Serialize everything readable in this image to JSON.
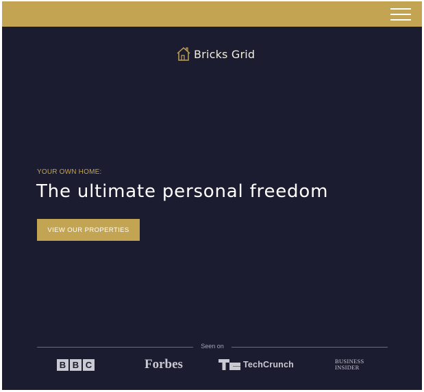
{
  "header": {
    "menu_icon": "hamburger-icon",
    "logo": {
      "text": "Bricks Grid",
      "icon": "house-outline-icon"
    }
  },
  "hero": {
    "eyebrow": "YOUR OWN HOME:",
    "headline": "The ultimate personal freedom",
    "cta_label": "VIEW OUR PROPERTIES"
  },
  "press": {
    "label": "Seen on",
    "brands": [
      "BBC",
      "Forbes",
      "TechCrunch",
      "Business Insider"
    ],
    "bbc_letters": [
      "B",
      "B",
      "C"
    ],
    "forbes_text": "Forbes",
    "techcrunch_text": "TechCrunch",
    "business_insider_lines": [
      "BUSINESS",
      "INSIDER"
    ]
  },
  "colors": {
    "background": "#1b1c2f",
    "accent": "#c3a452",
    "text_light": "#ffffff"
  }
}
